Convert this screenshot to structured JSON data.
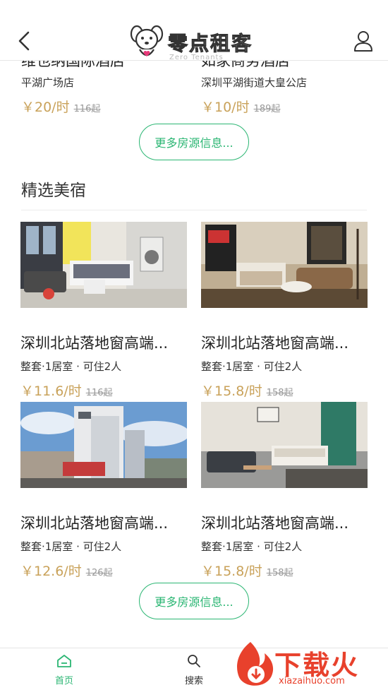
{
  "header": {
    "logo_text": "零点租客",
    "logo_sub": "Zero Tenants"
  },
  "top_listings": [
    {
      "name": "维也纳国际酒店",
      "location": "平湖广场店",
      "price": "￥20/时",
      "original": "116起"
    },
    {
      "name": "如家商务酒店",
      "location": "深圳平湖街道大皇公店",
      "price": "￥10/时",
      "original": "189起"
    }
  ],
  "more_button_label": "更多房源信息...",
  "section": {
    "title": "精选美宿",
    "listings": [
      {
        "name": "深圳北站落地窗高端...",
        "details": "整套·1居室 · 可住2人",
        "price": "￥11.6/时",
        "original": "116起"
      },
      {
        "name": "深圳北站落地窗高端...",
        "details": "整套·1居室 · 可住2人",
        "price": "￥15.8/时",
        "original": "158起"
      },
      {
        "name": "深圳北站落地窗高端...",
        "details": "整套·1居室 · 可住2人",
        "price": "￥12.6/时",
        "original": "126起"
      },
      {
        "name": "深圳北站落地窗高端...",
        "details": "整套·1居室 · 可住2人",
        "price": "￥15.8/时",
        "original": "158起"
      }
    ]
  },
  "bottom_nav": {
    "home_label": "首页",
    "search_label": "搜索"
  },
  "watermark": {
    "title": "下载火",
    "url": "xiazaihuo.com"
  },
  "colors": {
    "accent_green": "#2bb673",
    "price_gold": "#c9a25a",
    "watermark_red": "#e8412c"
  }
}
